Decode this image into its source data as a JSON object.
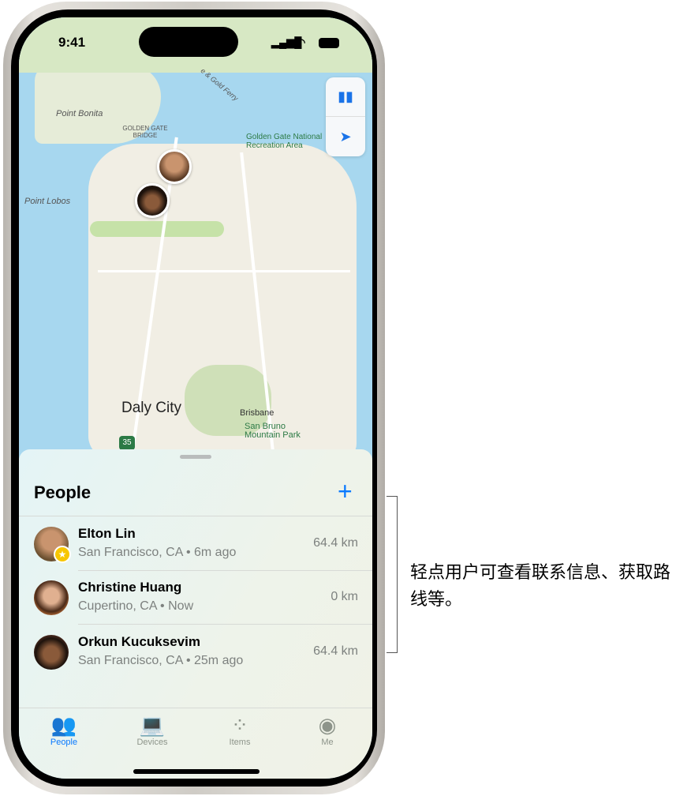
{
  "status_bar": {
    "time": "9:41"
  },
  "map": {
    "labels": {
      "point_bonita": "Point Bonita",
      "bridge": "GOLDEN GATE BRIDGE",
      "ggnra": "Golden Gate National Recreation Area",
      "point_lobos": "Point Lobos",
      "ferry": "e & Gold Ferry",
      "daly_city": "Daly City",
      "brisbane": "Brisbane",
      "san_bruno": "San Bruno Mountain Park",
      "highway": "35"
    }
  },
  "sheet": {
    "title": "People",
    "people": [
      {
        "name": "Elton Lin",
        "location": "San Francisco, CA",
        "time": "6m ago",
        "distance": "64.4 km",
        "favorite": true
      },
      {
        "name": "Christine Huang",
        "location": "Cupertino, CA",
        "time": "Now",
        "distance": "0 km",
        "favorite": false
      },
      {
        "name": "Orkun Kucuksevim",
        "location": "San Francisco, CA",
        "time": "25m ago",
        "distance": "64.4 km",
        "favorite": false
      }
    ]
  },
  "tabs": [
    {
      "label": "People",
      "active": true
    },
    {
      "label": "Devices"
    },
    {
      "label": "Items"
    },
    {
      "label": "Me"
    }
  ],
  "callout": {
    "text": "轻点用户可查看联系信息、获取路线等。"
  },
  "colors": {
    "accent": "#0A7AFF",
    "favorite": "#F7C600"
  }
}
